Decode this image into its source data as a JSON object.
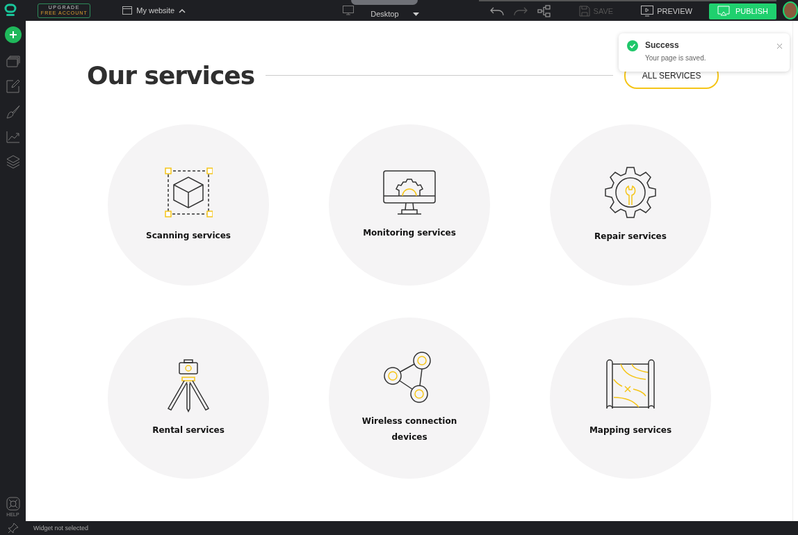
{
  "topbar": {
    "upgrade": {
      "line1": "UPGRADE",
      "line2": "FREE ACCOUNT"
    },
    "site": "My website",
    "device": "Desktop",
    "save": {
      "label": "SAVE",
      "disabled": true
    },
    "preview": "PREVIEW",
    "publish": "PUBLISH"
  },
  "sidebar": {
    "help": "HELP"
  },
  "page": {
    "title": "Our services",
    "all_button": "ALL SERVICES",
    "services": [
      {
        "name": "Scanning services"
      },
      {
        "name": "Monitoring services"
      },
      {
        "name": "Repair services"
      },
      {
        "name": "Rental services"
      },
      {
        "name": "Wireless connection devices"
      },
      {
        "name": "Mapping services"
      }
    ]
  },
  "toast": {
    "title": "Success",
    "message": "Your page is saved."
  },
  "status_bar": "Widget not selected"
}
